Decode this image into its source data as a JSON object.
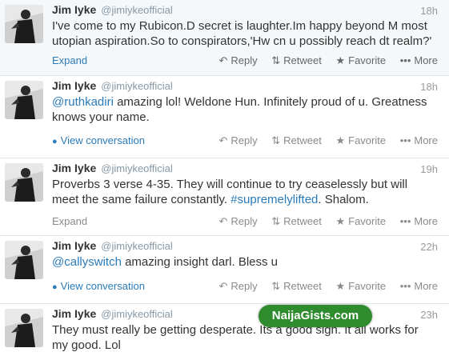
{
  "colors": {
    "link": "#2b7bb9",
    "text": "#333333",
    "meta": "#999999",
    "watermark_bg": "#2e8b2e"
  },
  "actions": {
    "reply": "Reply",
    "retweet": "Retweet",
    "favorite": "Favorite",
    "more": "More"
  },
  "icons": {
    "reply": "reply-icon",
    "retweet": "retweet-icon",
    "favorite": "star-icon",
    "more": "ellipsis-icon",
    "conversation": "speech-bubble-icon"
  },
  "tweets": [
    {
      "name": "Jim Iyke",
      "handle": "@jimiykeofficial",
      "time": "18h",
      "text": "I've come to my Rubicon.D secret is laughter.Im happy beyond M most utopian aspiration.So to conspirators,'Hw cn u possibly reach dt realm?'",
      "footer": "Expand"
    },
    {
      "name": "Jim Iyke",
      "handle": "@jimiykeofficial",
      "time": "18h",
      "mention": "@ruthkadiri",
      "text": " amazing lol! Weldone Hun. Infinitely proud of u. Greatness knows your name.",
      "footer": "View conversation"
    },
    {
      "name": "Jim Iyke",
      "handle": "@jimiykeofficial",
      "time": "19h",
      "text": "Proverbs 3 verse 4-35. They will continue to try ceaselessly but will meet the same failure constantly. ",
      "hashtag": "#supremelylifted",
      "text_after": ". Shalom.",
      "footer": "Expand"
    },
    {
      "name": "Jim Iyke",
      "handle": "@jimiykeofficial",
      "time": "22h",
      "mention": "@callyswitch",
      "text": " amazing insight darl. Bless u",
      "footer": "View conversation"
    },
    {
      "name": "Jim Iyke",
      "handle": "@jimiykeofficial",
      "time": "23h",
      "text": "They must really be getting desperate. Its a good sign. It all works for my good. Lol"
    }
  ],
  "watermark": "NaijaGists.com"
}
